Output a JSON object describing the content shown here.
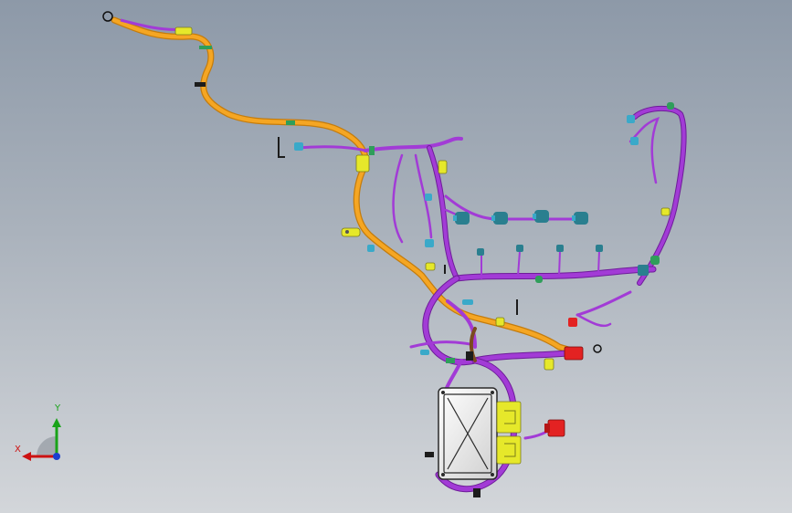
{
  "viewport": {
    "background_top": "#8d99a8",
    "background_bottom": "#d3d6da"
  },
  "colors": {
    "main_trunk": "#f5a623",
    "main_trunk_edge": "#c47c0d",
    "branch": "#a23bd6",
    "branch_edge": "#6e1d99",
    "connector": "#2a7f8f",
    "connector_light": "#3aa9c9",
    "clip_yellow": "#e6e82a",
    "clip_green": "#2f9e5a",
    "connector_red": "#e32222",
    "ecu_body": "#f4f4f4",
    "ecu_outline": "#2a2a2a"
  },
  "orientation_triad": {
    "x_label": "X",
    "y_label": "Y",
    "x_color": "#cc1111",
    "y_color": "#19a319",
    "z_color": "#1a3fcf"
  },
  "icons": {
    "ecu": "ecu-module-icon",
    "connector": "connector-icon",
    "clip": "harness-clip-icon",
    "triad": "axis-triad-icon"
  }
}
